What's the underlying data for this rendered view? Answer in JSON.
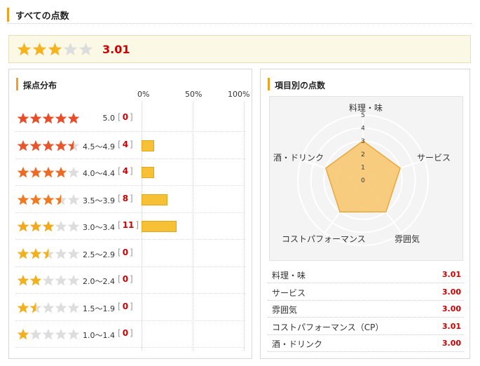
{
  "header": {
    "title": "すべての点数"
  },
  "overall": {
    "score": "3.01",
    "stars": [
      1,
      1,
      1,
      0,
      0
    ]
  },
  "distribution": {
    "title": "採点分布",
    "axis_labels": [
      "0%",
      "50%",
      "100%"
    ],
    "rows": [
      {
        "stars": [
          1,
          1,
          1,
          1,
          1
        ],
        "color": "#e84d2a",
        "range": "5.0",
        "count": "0",
        "share": 0
      },
      {
        "stars": [
          1,
          1,
          1,
          1,
          0.5
        ],
        "color": "#e8562b",
        "range": "4.5～4.9",
        "count": "4",
        "share": 0.062
      },
      {
        "stars": [
          1,
          1,
          1,
          1,
          0
        ],
        "color": "#ec6a23",
        "range": "4.0～4.4",
        "count": "4",
        "share": 0.062
      },
      {
        "stars": [
          1,
          1,
          1,
          0.5,
          0
        ],
        "color": "#ef7a21",
        "range": "3.5～3.9",
        "count": "8",
        "share": 0.125
      },
      {
        "stars": [
          1,
          1,
          1,
          0,
          0
        ],
        "color": "#f2a91e",
        "range": "3.0～3.4",
        "count": "11",
        "share": 0.172
      },
      {
        "stars": [
          1,
          1,
          0.5,
          0,
          0
        ],
        "color": "#f2b01e",
        "range": "2.5～2.9",
        "count": "0",
        "share": 0
      },
      {
        "stars": [
          1,
          1,
          0,
          0,
          0
        ],
        "color": "#f2b01e",
        "range": "2.0～2.4",
        "count": "0",
        "share": 0
      },
      {
        "stars": [
          1,
          0.5,
          0,
          0,
          0
        ],
        "color": "#f2b01e",
        "range": "1.5～1.9",
        "count": "0",
        "share": 0
      },
      {
        "stars": [
          1,
          0,
          0,
          0,
          0
        ],
        "color": "#f2b01e",
        "range": "1.0～1.4",
        "count": "0",
        "share": 0
      }
    ]
  },
  "items": {
    "title": "項目別の点数",
    "radar": {
      "axes": [
        "料理・味",
        "サービス",
        "雰囲気",
        "コストパフォーマンス",
        "酒・ドリンク"
      ],
      "values": [
        3.01,
        3.0,
        3.0,
        3.01,
        3.0
      ],
      "max": 5,
      "scale_labels": [
        "0",
        "1",
        "2",
        "3",
        "4",
        "5"
      ]
    },
    "list": [
      {
        "label": "料理・味",
        "value": "3.01"
      },
      {
        "label": "サービス",
        "value": "3.00"
      },
      {
        "label": "雰囲気",
        "value": "3.00"
      },
      {
        "label": "コストパフォーマンス（CP）",
        "value": "3.01"
      },
      {
        "label": "酒・ドリンク",
        "value": "3.00"
      }
    ]
  },
  "colors": {
    "star_gold": "#f5b321",
    "star_empty": "#dddddd",
    "accent_bar": "#f0a020",
    "score_red": "#cc0000",
    "bar_fill": "#f7c136",
    "radar_fill": "#f7c46a"
  }
}
